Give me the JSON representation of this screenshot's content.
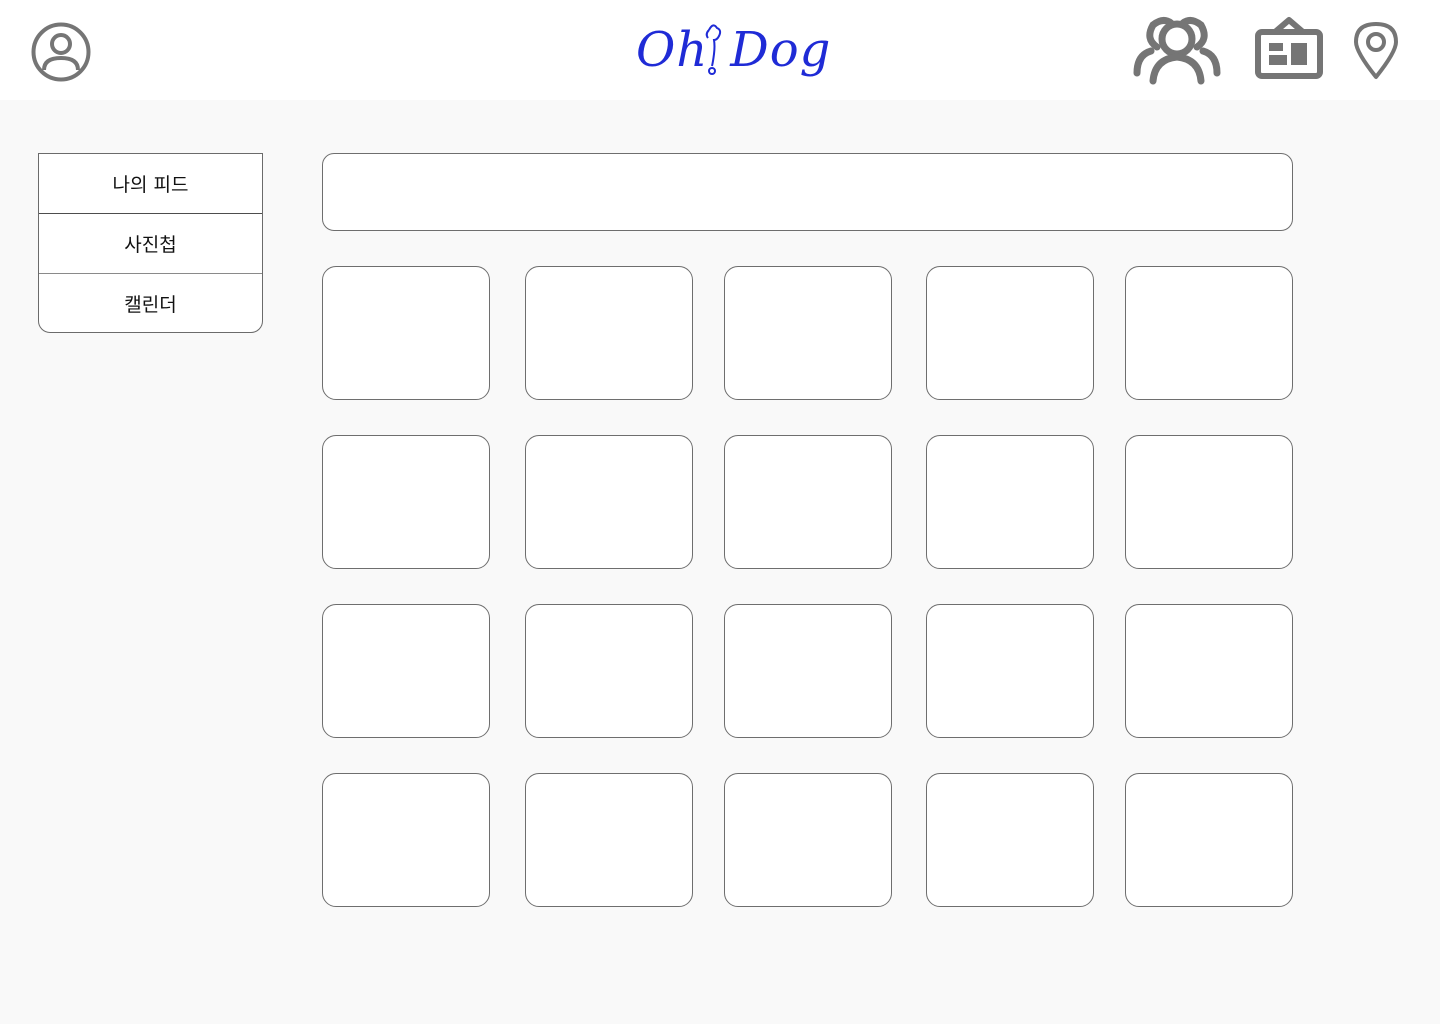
{
  "app": {
    "logo_text": "Oh Dog",
    "logo_color": "#1f2bd6"
  },
  "header": {
    "icons": [
      "profile-icon",
      "friends-icon",
      "board-icon",
      "location-icon"
    ],
    "icon_color": "#757575"
  },
  "sidebar": {
    "items": [
      {
        "label": "나의 피드"
      },
      {
        "label": "사진첩"
      },
      {
        "label": "캘린더"
      }
    ]
  },
  "search": {
    "value": "",
    "placeholder": ""
  },
  "gallery": {
    "rows": 4,
    "columns": 5,
    "tiles": 20
  }
}
